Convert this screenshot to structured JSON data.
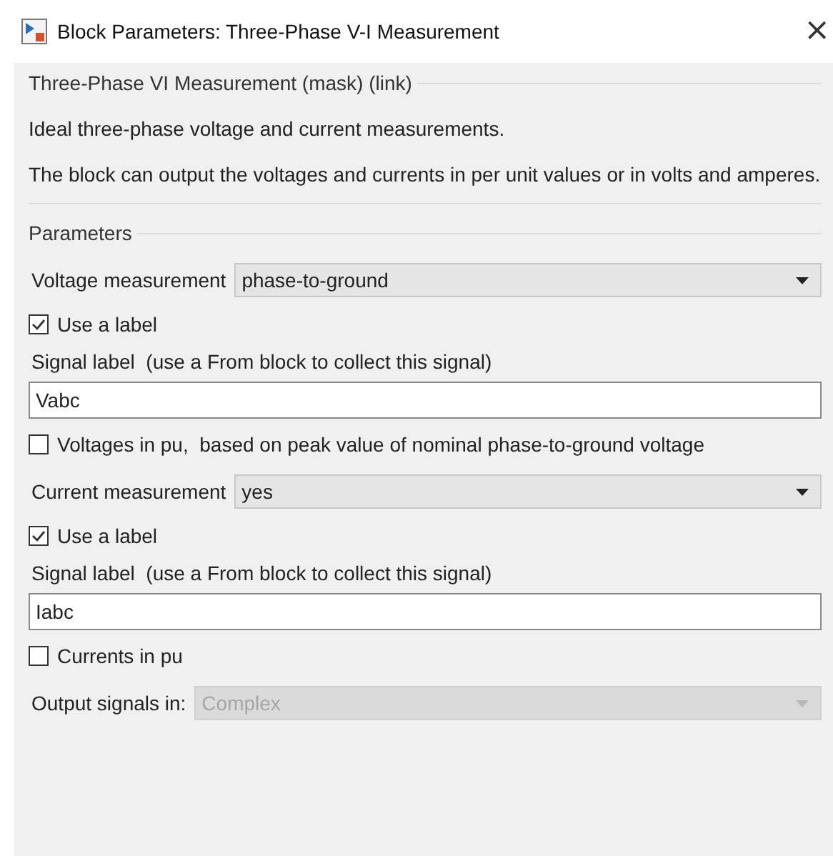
{
  "window": {
    "title": "Block Parameters: Three-Phase V-I Measurement",
    "close": "×"
  },
  "mask": {
    "title": "Three-Phase VI Measurement (mask) (link)",
    "paragraphs": [
      "Ideal three-phase voltage and current measurements.",
      "The block can output the voltages and currents in per unit values or in volts and amperes."
    ]
  },
  "parameters": {
    "title": "Parameters",
    "items": [
      {
        "kind": "dropdown",
        "label": "Voltage measurement",
        "value": "phase-to-ground",
        "disabled": false
      },
      {
        "kind": "checkbox",
        "label": "Use a label",
        "checked": true
      },
      {
        "kind": "text",
        "label": "Signal label  (use a From block to collect this signal)",
        "value": "Vabc"
      },
      {
        "kind": "checkbox",
        "label": "Voltages in pu,  based on peak value of nominal phase-to-ground voltage",
        "checked": false
      },
      {
        "kind": "dropdown",
        "label": "Current measurement",
        "value": "yes",
        "disabled": false
      },
      {
        "kind": "checkbox",
        "label": "Use a label",
        "checked": true
      },
      {
        "kind": "text",
        "label": "Signal label  (use a From block to collect this signal)",
        "value": "Iabc"
      },
      {
        "kind": "checkbox",
        "label": "Currents in pu",
        "checked": false
      },
      {
        "kind": "dropdown",
        "label": "Output signals in:",
        "value": "Complex",
        "disabled": true
      }
    ]
  }
}
